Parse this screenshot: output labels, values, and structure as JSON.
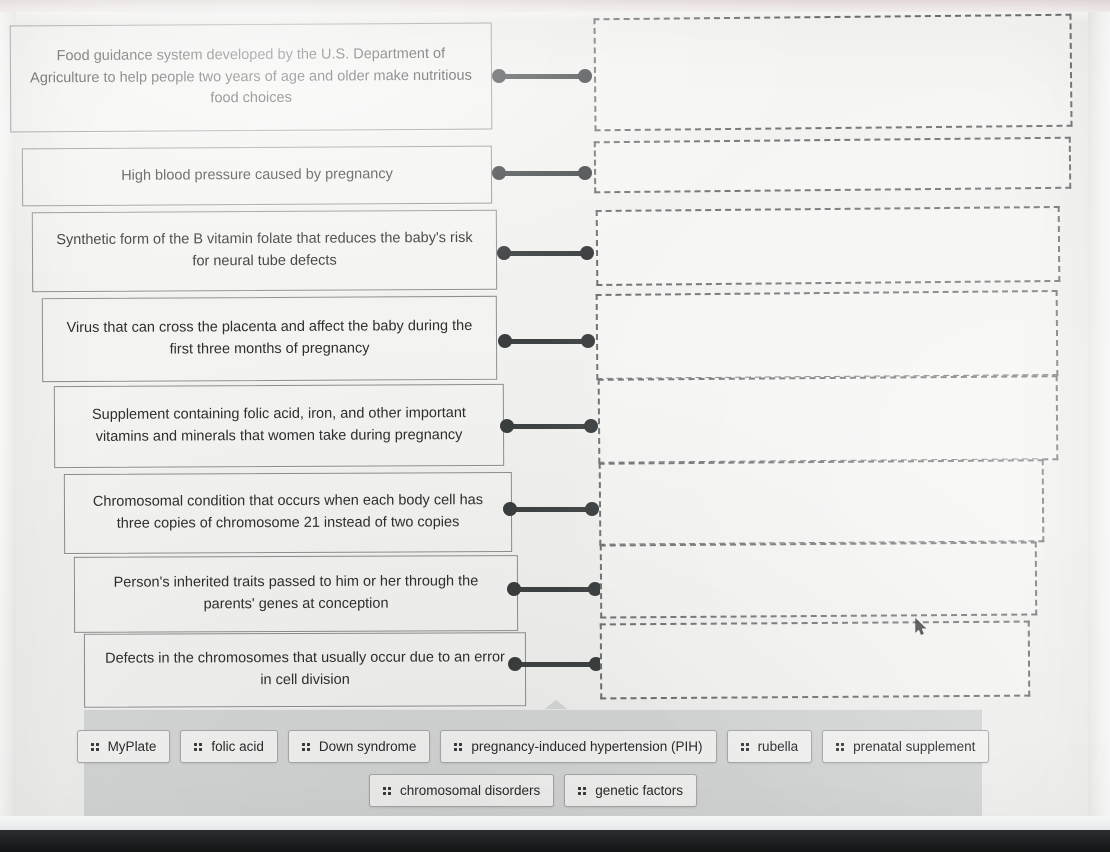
{
  "activity": {
    "type": "drag-and-drop matching",
    "rows": [
      {
        "prompt": "Food guidance system developed by the U.S. Department of Agriculture to help people two years of age and older make nutritious food choices",
        "answer": ""
      },
      {
        "prompt": "High blood pressure caused by pregnancy",
        "answer": ""
      },
      {
        "prompt": "Synthetic form of the B vitamin folate that reduces the baby's risk for neural tube defects",
        "answer": ""
      },
      {
        "prompt": "Virus that can cross the placenta and affect the baby during the first three months of pregnancy",
        "answer": ""
      },
      {
        "prompt": "Supplement containing folic acid, iron, and other important vitamins and minerals that women take during pregnancy",
        "answer": ""
      },
      {
        "prompt": "Chromosomal condition that occurs when each body cell has three copies of chromosome 21 instead of two copies",
        "answer": ""
      },
      {
        "prompt": "Person's inherited traits passed to him or her through the parents' genes at conception",
        "answer": ""
      },
      {
        "prompt": "Defects in the chromosomes that usually occur due to an error in cell division",
        "answer": ""
      }
    ]
  },
  "answer_bank": {
    "row1": [
      {
        "label": "MyPlate",
        "icon": "drag-handle-icon"
      },
      {
        "label": "folic acid",
        "icon": "drag-handle-icon"
      },
      {
        "label": "Down syndrome",
        "icon": "drag-handle-icon"
      },
      {
        "label": "pregnancy-induced hypertension (PIH)",
        "icon": "drag-handle-icon"
      },
      {
        "label": "rubella",
        "icon": "drag-handle-icon"
      },
      {
        "label": "prenatal supplement",
        "icon": "drag-handle-icon"
      }
    ],
    "row2": [
      {
        "label": "chromosomal disorders",
        "icon": "drag-handle-icon"
      },
      {
        "label": "genetic factors",
        "icon": "drag-handle-icon"
      }
    ]
  },
  "colors": {
    "page_background": "#f1f1ef",
    "prompt_fill": "#f3f3f1",
    "prompt_border": "#8d8f8e",
    "dropzone_border": "#6e7071",
    "connector": "#3a3e3f",
    "tray_background": "#d6d8d8",
    "chip_fill": "#f4f4f3",
    "chip_border": "#a9abab",
    "text": "#2e2e2e"
  }
}
